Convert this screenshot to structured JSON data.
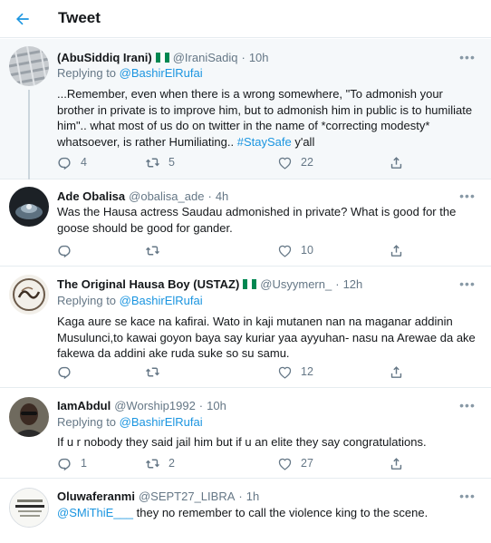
{
  "header": {
    "title": "Tweet"
  },
  "icons": {
    "back": "back-arrow-icon",
    "reply": "reply-icon",
    "retweet": "retweet-icon",
    "like": "heart-icon",
    "share": "share-icon",
    "more": "more-icon",
    "flag": "nigeria-flag-icon"
  },
  "colors": {
    "accent": "#1b95e0",
    "muted": "#657786",
    "flag_green": "#008751"
  },
  "tweets": [
    {
      "name": "(AbuSiddiq Irani)",
      "handle": "@IraniSadiq",
      "dot": "·",
      "time": "10h",
      "reply_prefix": "Replying to",
      "reply_to": "@BashirElRufai",
      "text_main": "...Remember, even when there is a wrong somewhere, \"To admonish your brother in private is to improve him, but to admonish him in public is to humiliate him\".. what most of us do on twitter in the name of *correcting modesty* whatsoever, is rather Humiliating..",
      "hashtag": "#StaySafe",
      "text_tail": "y'all",
      "replies": "4",
      "retweets": "5",
      "likes": "22"
    },
    {
      "name": "Ade Obalisa",
      "handle": "@obalisa_ade",
      "dot": "·",
      "time": "4h",
      "text": "Was the Hausa actress Saudau admonished in private? What is good for the goose should be good for gander.",
      "likes": "10"
    },
    {
      "name": "The Original Hausa Boy (USTAZ)",
      "handle": "@Usyymern_",
      "dot": "·",
      "time": "12h",
      "reply_prefix": "Replying to",
      "reply_to": "@BashirElRufai",
      "text": "Kaga aure se kace na kafirai. Wato in kaji mutanen nan na maganar addinin Musulunci,to kawai goyon baya say  kuriar yaa ayyuhan- nasu na Arewae  da ake fakewa da addini ake ruda suke so su samu.",
      "likes": "12"
    },
    {
      "name": "IamAbdul",
      "handle": "@Worship1992",
      "dot": "·",
      "time": "10h",
      "reply_prefix": "Replying to",
      "reply_to": "@BashirElRufai",
      "text": "If u r nobody they said jail him but if u an elite they say congratulations.",
      "replies": "1",
      "retweets": "2",
      "likes": "27"
    },
    {
      "name": "Oluwaferanmi",
      "handle": "@SEPT27_LIBRA",
      "dot": "·",
      "time": "1h",
      "mention": "@SMiThiE___",
      "text_tail": "they no remember to call the violence king to the scene."
    }
  ]
}
